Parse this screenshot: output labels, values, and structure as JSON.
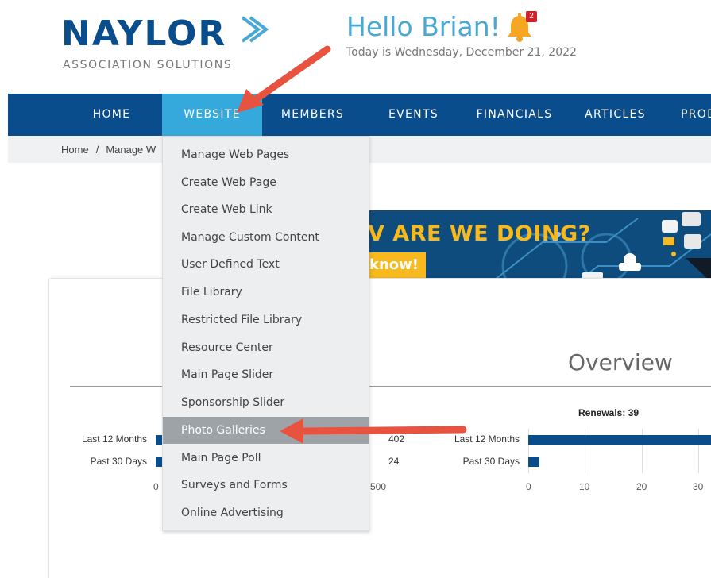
{
  "header": {
    "logo_word": "NAYLOR",
    "logo_tagline": "ASSOCIATION SOLUTIONS",
    "greeting": "Hello Brian!",
    "notification_count": "2",
    "today": "Today is Wednesday, December 21, 2022"
  },
  "nav": {
    "items": [
      {
        "label": "HOME",
        "active": false
      },
      {
        "label": "WEBSITE",
        "active": true
      },
      {
        "label": "MEMBERS",
        "active": false
      },
      {
        "label": "EVENTS",
        "active": false
      },
      {
        "label": "FINANCIALS",
        "active": false
      },
      {
        "label": "ARTICLES",
        "active": false
      },
      {
        "label": "PROD",
        "active": false
      }
    ]
  },
  "breadcrumb": {
    "home": "Home",
    "separator": "/",
    "current": "Manage W"
  },
  "website_menu": {
    "items": [
      "Manage Web Pages",
      "Create Web Page",
      "Create Web Link",
      "Manage Custom Content",
      "User Defined Text",
      "File Library",
      "Restricted File Library",
      "Resource Center",
      "Main Page Slider",
      "Sponsorship Slider",
      "Photo Galleries",
      "Main Page Poll",
      "Surveys and Forms",
      "Online Advertising"
    ],
    "highlighted": "Photo Galleries"
  },
  "banner": {
    "title": "V ARE WE DOING?",
    "cta": "know!"
  },
  "overview": {
    "title": "Overview"
  },
  "chart_data": [
    {
      "type": "bar",
      "orientation": "horizontal",
      "title": "",
      "categories": [
        "Last 12 Months",
        "Past 30 Days"
      ],
      "values": [
        402,
        24
      ],
      "value_labels": [
        "402",
        "24"
      ],
      "xlim": [
        0,
        500
      ],
      "xticks": [
        "0",
        "500"
      ]
    },
    {
      "type": "bar",
      "orientation": "horizontal",
      "title": "Renewals: 39",
      "categories": [
        "Last 12 Months",
        "Past 30 Days"
      ],
      "values": [
        39,
        2
      ],
      "xlim": [
        0,
        30
      ],
      "xticks": [
        "0",
        "10",
        "20",
        "30"
      ]
    }
  ],
  "colors": {
    "nav_bg": "#0a4d8c",
    "nav_active": "#35a8dc",
    "greeting": "#4aa8d6",
    "menu_highlight": "#9ea3a7",
    "annotation_arrow": "#e8533f",
    "banner_accent": "#f7b91d"
  }
}
